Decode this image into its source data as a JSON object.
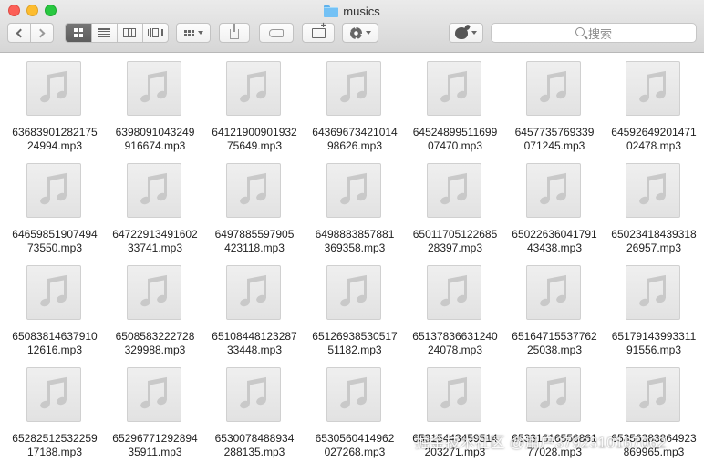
{
  "window": {
    "title": "musics"
  },
  "toolbar": {
    "search_placeholder": "搜索"
  },
  "files": [
    [
      "63683901282175",
      "24994.mp3"
    ],
    [
      "6398091043249",
      "916674.mp3"
    ],
    [
      "64121900901932",
      "75649.mp3"
    ],
    [
      "64369673421014",
      "98626.mp3"
    ],
    [
      "64524899511699",
      "07470.mp3"
    ],
    [
      "6457735769339",
      "071245.mp3"
    ],
    [
      "64592649201471",
      "02478.mp3"
    ],
    [
      "64659851907494",
      "73550.mp3"
    ],
    [
      "64722913491602",
      "33741.mp3"
    ],
    [
      "6497885597905",
      "423118.mp3"
    ],
    [
      "6498883857881",
      "369358.mp3"
    ],
    [
      "65011705122685",
      "28397.mp3"
    ],
    [
      "65022636041791",
      "43438.mp3"
    ],
    [
      "65023418439318",
      "26957.mp3"
    ],
    [
      "65083814637910",
      "12616.mp3"
    ],
    [
      "6508583222728",
      "329988.mp3"
    ],
    [
      "65108448123287",
      "33448.mp3"
    ],
    [
      "65126938530517",
      "51182.mp3"
    ],
    [
      "65137836631240",
      "24078.mp3"
    ],
    [
      "65164715537762",
      "25038.mp3"
    ],
    [
      "65179143993311",
      "91556.mp3"
    ],
    [
      "65282512532259",
      "17188.mp3"
    ],
    [
      "65296771292894",
      "35911.mp3"
    ],
    [
      "6530078488934",
      "288135.mp3"
    ],
    [
      "6530560414962",
      "027268.mp3"
    ],
    [
      "65315443459514",
      "203271.mp3"
    ],
    [
      "65331616556861",
      "77028.mp3"
    ],
    [
      "65356383864923",
      "869965.mp3"
    ]
  ],
  "watermark": "掘金技术社区 @用户3792310167062"
}
